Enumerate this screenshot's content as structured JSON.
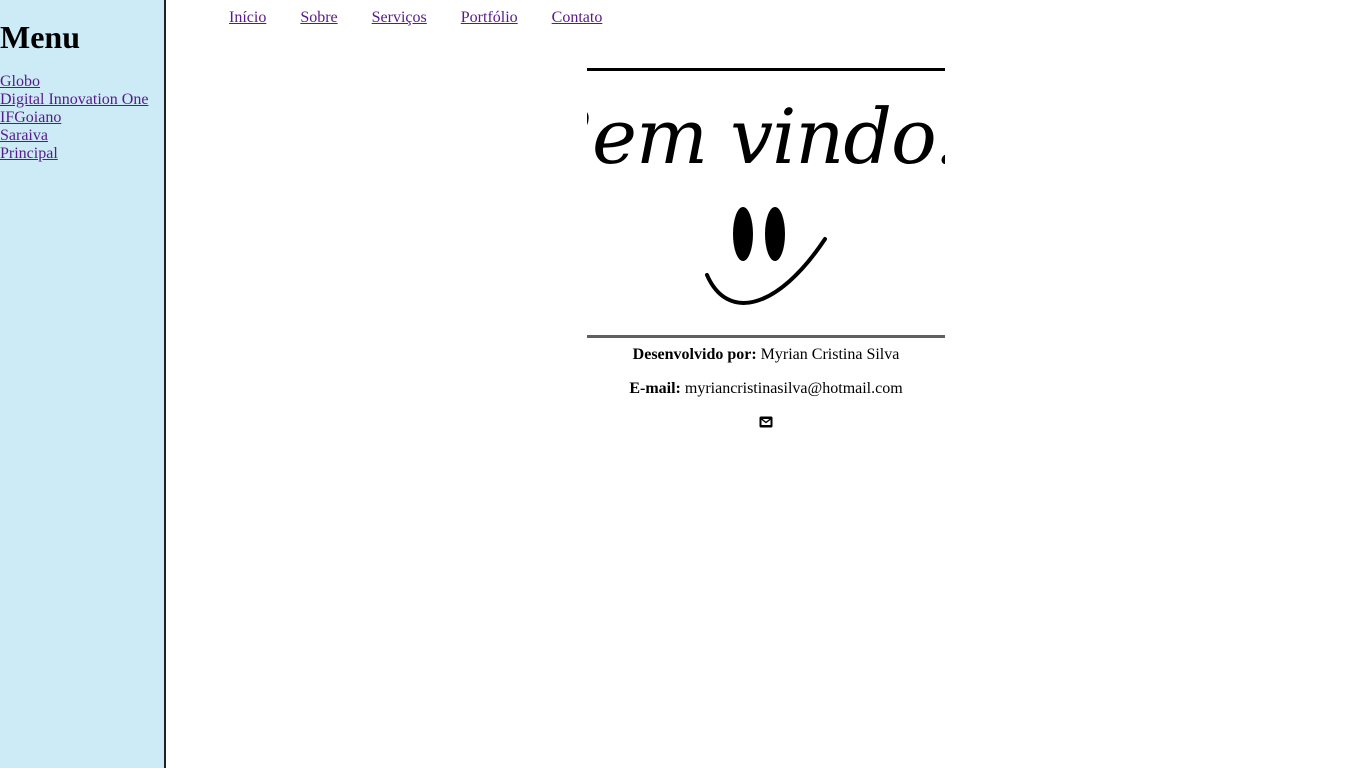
{
  "sidebar": {
    "title": "Menu",
    "links": [
      "Globo",
      "Digital Innovation One",
      "IFGoiano",
      "Saraiva",
      "Principal"
    ]
  },
  "nav": {
    "links": [
      "Início",
      "Sobre",
      "Serviços",
      "Portfólio",
      "Contato"
    ]
  },
  "banner": {
    "text": "Bem vindo!!"
  },
  "footer": {
    "dev_label": "Desenvolvido por:",
    "dev_name": "Myrian Cristina Silva",
    "email_label": "E-mail:",
    "email": "myriancristinasilva@hotmail.com",
    "email_icon": "envelope-icon"
  },
  "colors": {
    "sidebar_bg": "#cdebf6",
    "link": "#551a8b"
  }
}
